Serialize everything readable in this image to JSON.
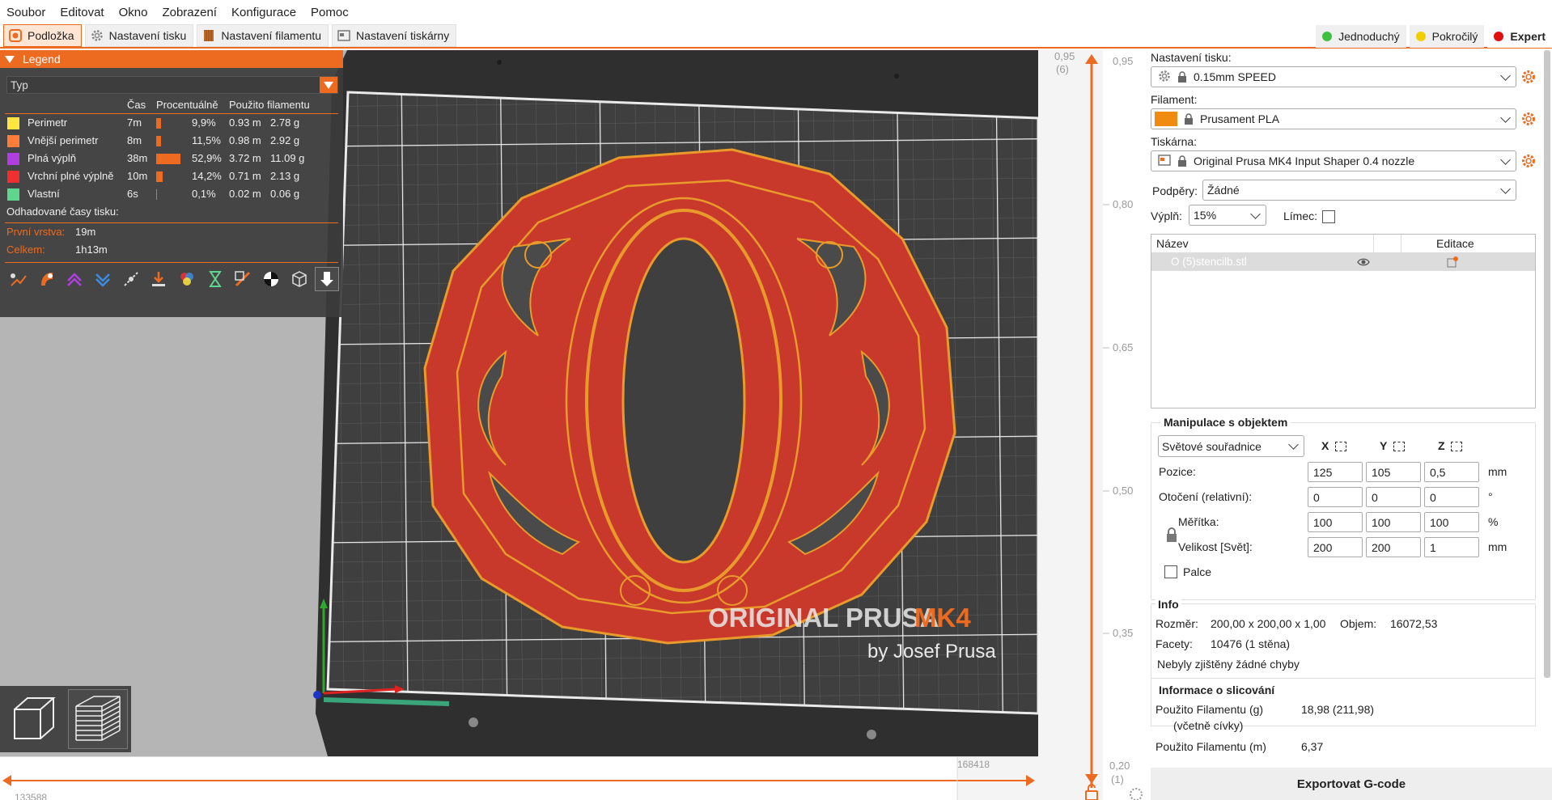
{
  "menu": [
    "Soubor",
    "Editovat",
    "Okno",
    "Zobrazení",
    "Konfigurace",
    "Pomoc"
  ],
  "tabs": [
    {
      "label": "Podložka",
      "icon": "plate-icon",
      "active": true
    },
    {
      "label": "Nastavení tisku",
      "icon": "gear-icon",
      "active": false
    },
    {
      "label": "Nastavení filamentu",
      "icon": "filament-icon",
      "active": false
    },
    {
      "label": "Nastavení tiskárny",
      "icon": "printer-icon",
      "active": false
    }
  ],
  "modes": [
    {
      "label": "Jednoduchý",
      "color": "#40c040"
    },
    {
      "label": "Pokročilý",
      "color": "#f0d000"
    },
    {
      "label": "Expert",
      "color": "#e01010"
    }
  ],
  "legend": {
    "title": "Legend",
    "type_select": "Typ",
    "columns": {
      "time": "Čas",
      "percent": "Procentuálně",
      "used": "Použito filamentu"
    },
    "rows": [
      {
        "label": "Perimetr",
        "color": "#ffe640",
        "time": "7m",
        "percent": "9,9%",
        "fraction": 0.099,
        "meters": "0.93 m",
        "grams": "2.78 g"
      },
      {
        "label": "Vnější perimetr",
        "color": "#ff7d38",
        "time": "8m",
        "percent": "11,5%",
        "fraction": 0.115,
        "meters": "0.98 m",
        "grams": "2.92 g"
      },
      {
        "label": "Plná výplň",
        "color": "#b03ee0",
        "time": "38m",
        "percent": "52,9%",
        "fraction": 0.529,
        "meters": "3.72 m",
        "grams": "11.09 g"
      },
      {
        "label": "Vrchní plné výplně",
        "color": "#f03030",
        "time": "10m",
        "percent": "14,2%",
        "fraction": 0.142,
        "meters": "0.71 m",
        "grams": "2.13 g"
      },
      {
        "label": "Vlastní",
        "color": "#5ed68d",
        "time": "6s",
        "percent": "0,1%",
        "fraction": 0.001,
        "meters": "0.02 m",
        "grams": "0.06 g"
      }
    ],
    "estimates_title": "Odhadované časy tisku:",
    "first_layer_label": "První vrstva:",
    "first_layer_value": "19m",
    "total_label": "Celkem:",
    "total_value": "1h13m"
  },
  "bed": {
    "brand_text_1": "ORIGINAL PRUSA",
    "brand_text_2": "MK4",
    "brand_text_3": "by Josef Prusa"
  },
  "hslider": {
    "left_value": "133588",
    "right_value": "168418"
  },
  "vslider": {
    "top_label": "0,95",
    "top_sub": "(6)",
    "top_right": "0,95",
    "ticks": [
      "0,80",
      "0,65",
      "0,50",
      "0,35"
    ],
    "bottom_label": "0,20",
    "bottom_sub": "(1)"
  },
  "panel": {
    "print_settings_label": "Nastavení tisku:",
    "print_settings_value": "0.15mm SPEED",
    "filament_label": "Filament:",
    "filament_value": "Prusament PLA",
    "filament_color": "#f08a10",
    "printer_label": "Tiskárna:",
    "printer_value": "Original Prusa MK4 Input Shaper 0.4 nozzle",
    "supports_label": "Podpěry:",
    "supports_value": "Žádné",
    "infill_label": "Výplň:",
    "infill_value": "15%",
    "brim_label": "Límec:",
    "object_list": {
      "col_name": "Název",
      "col_edit": "Editace",
      "items": [
        {
          "name": "O (5)stencilb.stl"
        }
      ]
    },
    "manipulation": {
      "title": "Manipulace s objektem",
      "coord_select": "Světové souřadnice",
      "axes": [
        "X",
        "Y",
        "Z"
      ],
      "position_label": "Pozice:",
      "position": [
        "125",
        "105",
        "0,5"
      ],
      "position_unit": "mm",
      "rotation_label": "Otočení (relativní):",
      "rotation": [
        "0",
        "0",
        "0"
      ],
      "rotation_unit": "°",
      "scale_label": "Měřítka:",
      "scale": [
        "100",
        "100",
        "100"
      ],
      "scale_unit": "%",
      "size_label": "Velikost [Svět]:",
      "size": [
        "200",
        "200",
        "1"
      ],
      "size_unit": "mm",
      "inches_label": "Palce"
    },
    "info": {
      "title": "Info",
      "size_label": "Rozměr:",
      "size_value": "200,00 x 200,00 x 1,00",
      "volume_label": "Objem:",
      "volume_value": "16072,53",
      "facets_label": "Facety:",
      "facets_value": "10476 (1 stěna)",
      "errors": "Nebyly zjištěny žádné chyby"
    },
    "slice_info": {
      "title": "Informace o slicování",
      "used_g_label": "Použito Filamentu (g)",
      "used_g_sub": "(včetně cívky)",
      "used_g_value": "18,98 (211,98)",
      "used_m_label": "Použito Filamentu (m)",
      "used_m_value": "6,37"
    },
    "export_button": "Exportovat G-code"
  }
}
